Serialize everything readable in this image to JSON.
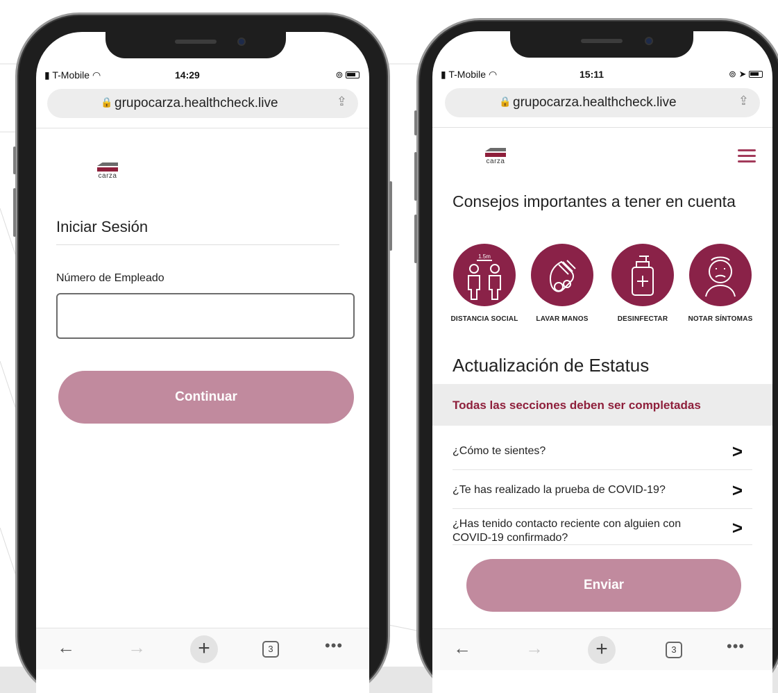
{
  "left_phone": {
    "status": {
      "carrier": "T-Mobile",
      "time": "14:29"
    },
    "url": "grupocarza.healthcheck.live",
    "logo_text": "carza",
    "login": {
      "title": "Iniciar Sesión",
      "field_label": "Número de Empleado",
      "field_value": "",
      "continue_label": "Continuar"
    },
    "toolbar": {
      "back": "←",
      "forward": "→",
      "new_tab": "+",
      "tab_count": "3",
      "more": "•••"
    }
  },
  "right_phone": {
    "status": {
      "carrier": "T-Mobile",
      "time": "15:11"
    },
    "url": "grupocarza.healthcheck.live",
    "logo_text": "carza",
    "tips_title": "Consejos importantes a tener en cuenta",
    "tips": [
      {
        "icon": "social-distance-icon",
        "label": "DISTANCIA SOCIAL",
        "badge": "1.5m"
      },
      {
        "icon": "wash-hands-icon",
        "label": "LAVAR MANOS"
      },
      {
        "icon": "sanitizer-icon",
        "label": "DESINFECTAR"
      },
      {
        "icon": "symptoms-icon",
        "label": "NOTAR SÍNTOMAS"
      }
    ],
    "status_title": "Actualización de Estatus",
    "banner": "Todas las secciones deben ser completadas",
    "questions": [
      "¿Cómo te sientes?",
      "¿Te has realizado la prueba de COVID-19?",
      "¿Has tenido contacto reciente con alguien con COVID-19 confirmado?"
    ],
    "send_label": "Enviar",
    "toolbar": {
      "back": "←",
      "forward": "→",
      "new_tab": "+",
      "tab_count": "3",
      "more": "•••"
    }
  },
  "colors": {
    "accent": "#8a2248",
    "button": "#c18a9e",
    "banner_text": "#8e1f3b",
    "menu_icon": "#a23a5a"
  }
}
